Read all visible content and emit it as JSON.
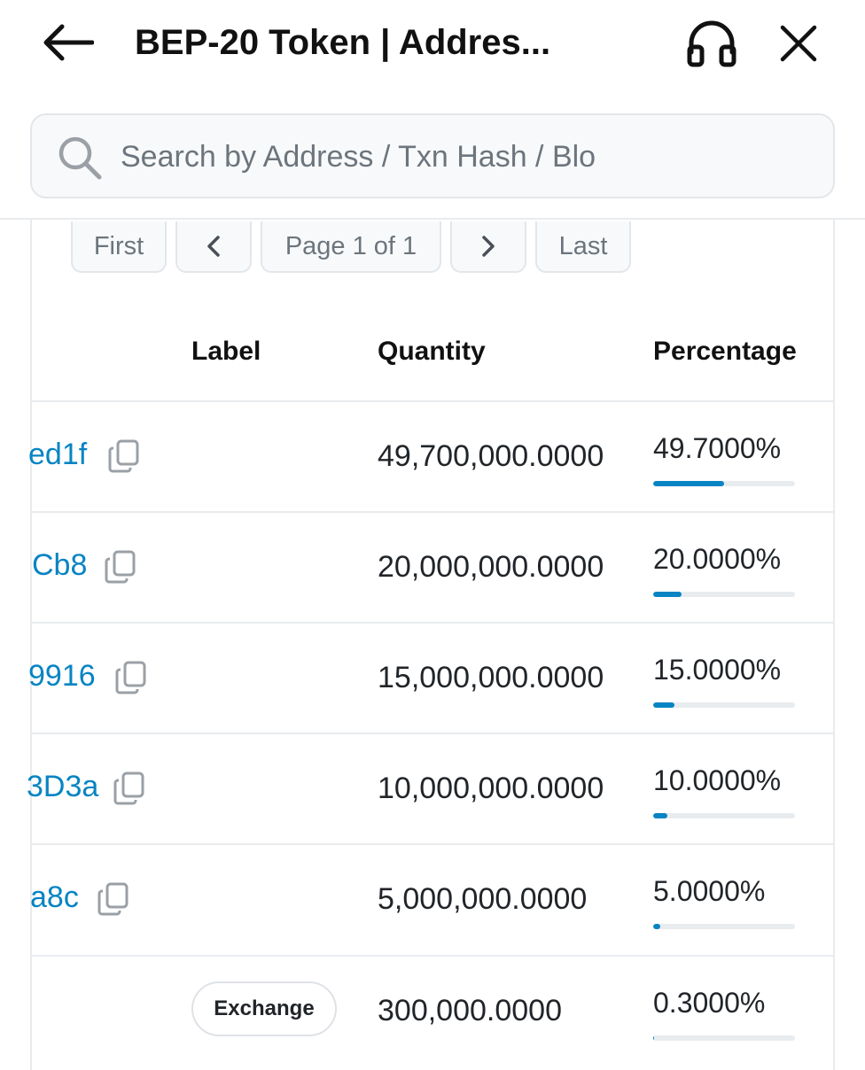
{
  "header": {
    "title": "BEP-20 Token | Addres...",
    "back_icon": "arrow-left-icon",
    "support_icon": "headphones-icon",
    "close_icon": "close-icon"
  },
  "search": {
    "placeholder": "Search by Address / Txn Hash / Blo",
    "value": ""
  },
  "pagination": {
    "first": "First",
    "prev": "‹",
    "info": "Page 1 of 1",
    "next": "›",
    "last": "Last"
  },
  "table": {
    "columns": [
      "Label",
      "Quantity",
      "Percentage"
    ],
    "rows": [
      {
        "address": "ed1f",
        "label": "",
        "quantity": "49,700,000.0000",
        "percentage": "49.7000%",
        "share": 49.7
      },
      {
        "address": "Cb8",
        "label": "",
        "quantity": "20,000,000.0000",
        "percentage": "20.0000%",
        "share": 20.0
      },
      {
        "address": "9916",
        "label": "",
        "quantity": "15,000,000.0000",
        "percentage": "15.0000%",
        "share": 15.0
      },
      {
        "address": "3D3a",
        "label": "",
        "quantity": "10,000,000.0000",
        "percentage": "10.0000%",
        "share": 10.0
      },
      {
        "address": "a8c",
        "label": "",
        "quantity": "5,000,000.0000",
        "percentage": "5.0000%",
        "share": 5.0
      },
      {
        "address": "",
        "label": "Exchange",
        "quantity": "300,000.0000",
        "percentage": "0.3000%",
        "share": 0.3
      }
    ]
  },
  "colors": {
    "link": "#0784c3",
    "bar_fill": "#0784c3",
    "bar_track": "#e9ecef"
  }
}
